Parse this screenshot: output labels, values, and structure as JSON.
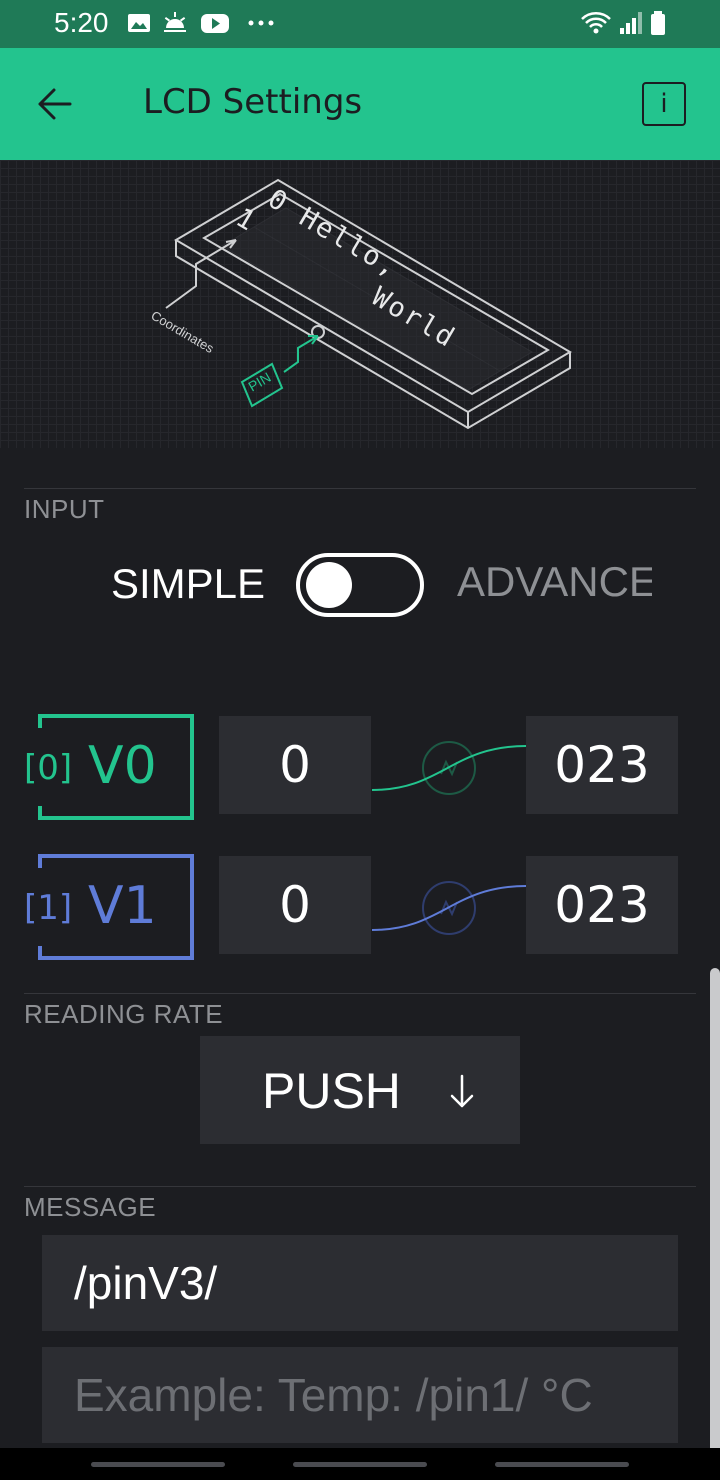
{
  "status_bar": {
    "time": "5:20",
    "icons": [
      "image-icon",
      "sunrise-icon",
      "youtube-icon",
      "more-dots-icon",
      "wifi-calling-icon",
      "signal-icon",
      "battery-icon"
    ]
  },
  "app_bar": {
    "title": "LCD Settings",
    "back_icon": "arrow-left-icon",
    "info_label": "i"
  },
  "illustration": {
    "row0_text": "0 Hello,",
    "row1_text": "1",
    "row1_word": "World",
    "coordinates_label": "Coordinates",
    "pin_label": "PIN"
  },
  "input": {
    "label": "INPUT",
    "mode_simple": "SIMPLE",
    "mode_advanced": "ADVANCED",
    "toggle_on": false
  },
  "pins": [
    {
      "index": "[0]",
      "name": "V0",
      "min": "0",
      "max": "023",
      "color": "#23c48e"
    },
    {
      "index": "[1]",
      "name": "V1",
      "min": "0",
      "max": "023",
      "color": "#5f7cd8"
    }
  ],
  "reading_rate": {
    "label": "READING RATE",
    "value": "PUSH",
    "icon": "arrow-down-icon"
  },
  "message": {
    "label": "MESSAGE",
    "value": "/pinV3/",
    "placeholder": "Example: Temp: /pin1/ °C"
  },
  "colors": {
    "accent": "#23c48e",
    "accent_dark": "#1f7a57",
    "pin1": "#5f7cd8",
    "background": "#1c1d21",
    "field": "#2c2d32"
  }
}
